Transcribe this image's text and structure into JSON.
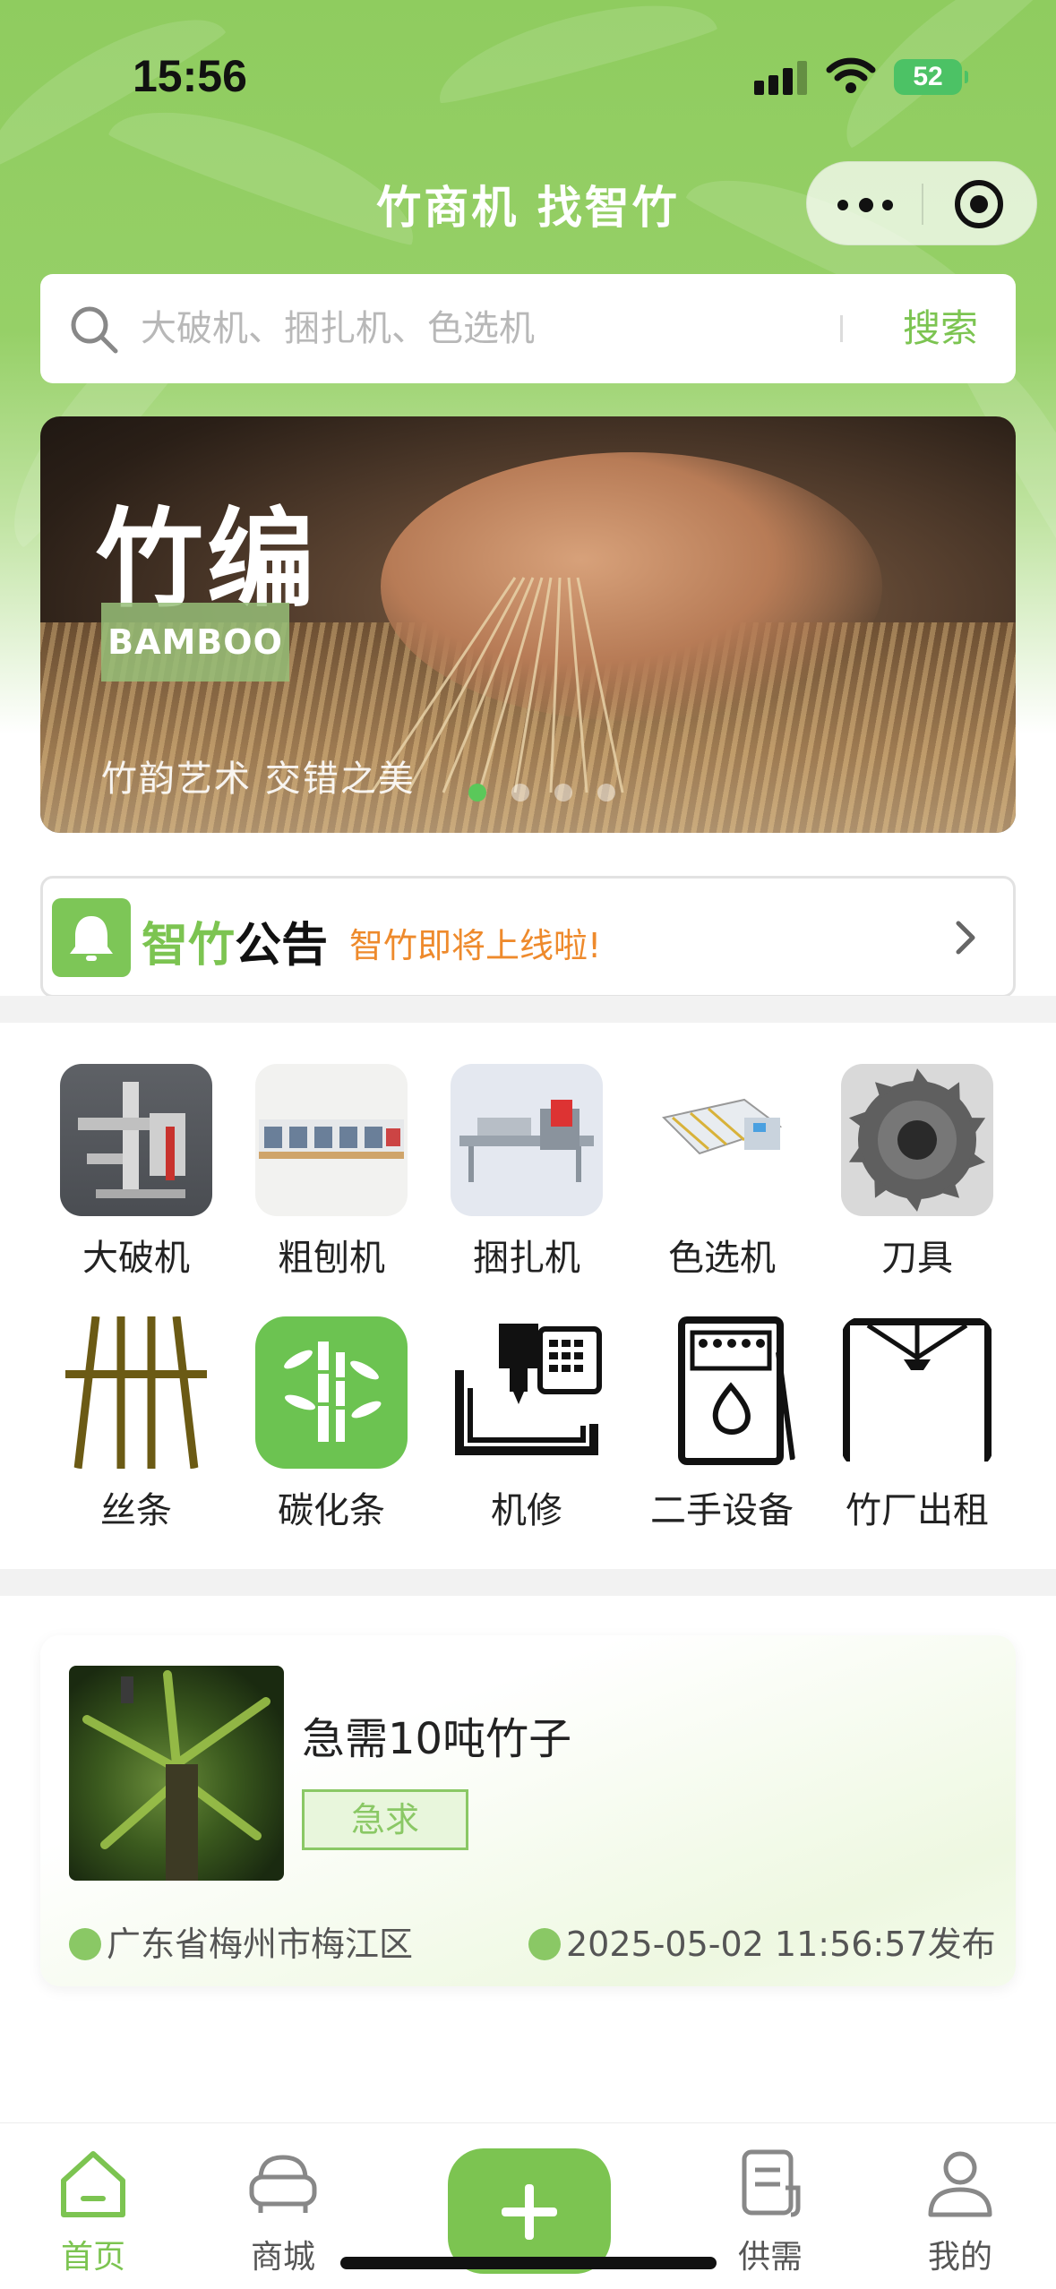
{
  "status_bar": {
    "time": "15:56",
    "battery": "52"
  },
  "nav": {
    "title": "竹商机 找智竹"
  },
  "search": {
    "placeholder": "大破机、捆扎机、色选机",
    "button": "搜索"
  },
  "banner": {
    "title": "竹编",
    "badge": "BAMBOO",
    "subtitle": "竹韵艺术 交错之美",
    "active_index": 0,
    "slide_count": 4
  },
  "notice": {
    "brand_green": "智竹",
    "brand_black": "公告",
    "text": "智竹即将上线啦!"
  },
  "categories": [
    {
      "label": "大破机",
      "icon": "bamboo-splitter-machine-icon"
    },
    {
      "label": "粗刨机",
      "icon": "rough-planer-machine-icon"
    },
    {
      "label": "捆扎机",
      "icon": "bundling-machine-icon"
    },
    {
      "label": "色选机",
      "icon": "color-sorter-machine-icon"
    },
    {
      "label": "刀具",
      "icon": "saw-blade-icon"
    },
    {
      "label": "丝条",
      "icon": "strips-icon"
    },
    {
      "label": "碳化条",
      "icon": "bamboo-carbonized-icon"
    },
    {
      "label": "机修",
      "icon": "cnc-repair-icon"
    },
    {
      "label": "二手设备",
      "icon": "secondhand-equipment-icon"
    },
    {
      "label": "竹厂出租",
      "icon": "factory-rent-icon"
    }
  ],
  "post": {
    "title": "急需10吨竹子",
    "tag": "急求",
    "location": "广东省梅州市梅江区",
    "time": "2025-05-02 11:56:57发布"
  },
  "tabbar": {
    "items": [
      {
        "label": "首页",
        "icon": "home-icon"
      },
      {
        "label": "商城",
        "icon": "sofa-icon"
      },
      {
        "label": "供需",
        "icon": "document-icon"
      },
      {
        "label": "我的",
        "icon": "user-icon"
      }
    ],
    "active": "首页"
  },
  "colors": {
    "accent": "#7cc451",
    "notice_text": "#ee8a2c",
    "header_green": "#8fcc5f"
  }
}
